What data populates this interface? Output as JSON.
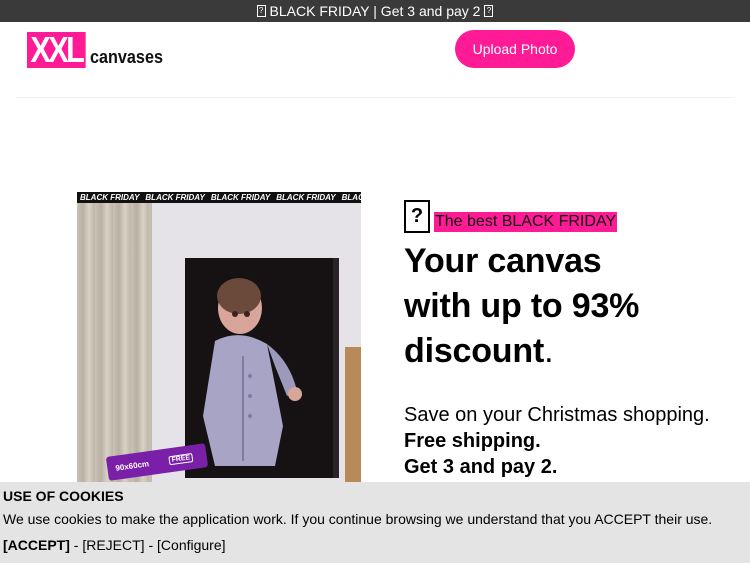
{
  "promo": {
    "glyph": "?",
    "text": "BLACK FRIDAY | Get 3 and pay 2"
  },
  "header": {
    "logo_primary": "XXL",
    "logo_secondary": "canvases",
    "upload_button": "Upload Photo"
  },
  "hero": {
    "image": {
      "ribbon_text": [
        "BLACK FRIDAY",
        "BLACK FRIDAY",
        "BLACK FRIDAY",
        "BLACK FRIDAY",
        "BLACK FRIDAY"
      ],
      "size_badge": "90x60cm",
      "badge_icon": "FREE"
    },
    "tagline_glyph": "?",
    "tagline": "The best BLACK FRIDAY",
    "headline_line1": "Your canvas",
    "headline_line2": "with up to 93%",
    "headline_line3": "discount",
    "headline_end": ".",
    "sub_normal": "Save on your Christmas shopping.",
    "sub_bold1": "Free shipping.",
    "sub_bold2": "Get 3 and pay 2."
  },
  "cookies": {
    "title": "USE OF COOKIES",
    "text": "We use cookies to make the application work. If you continue browsing we understand that you ACCEPT their use.",
    "accept": "[ACCEPT]",
    "separator": " - ",
    "reject": "[REJECT]",
    "configure": "[Configure]"
  },
  "colors": {
    "brand_pink": "#ff1a96",
    "promo_bar": "#3a3a3a",
    "cookie_bar": "#e4e4e4"
  }
}
